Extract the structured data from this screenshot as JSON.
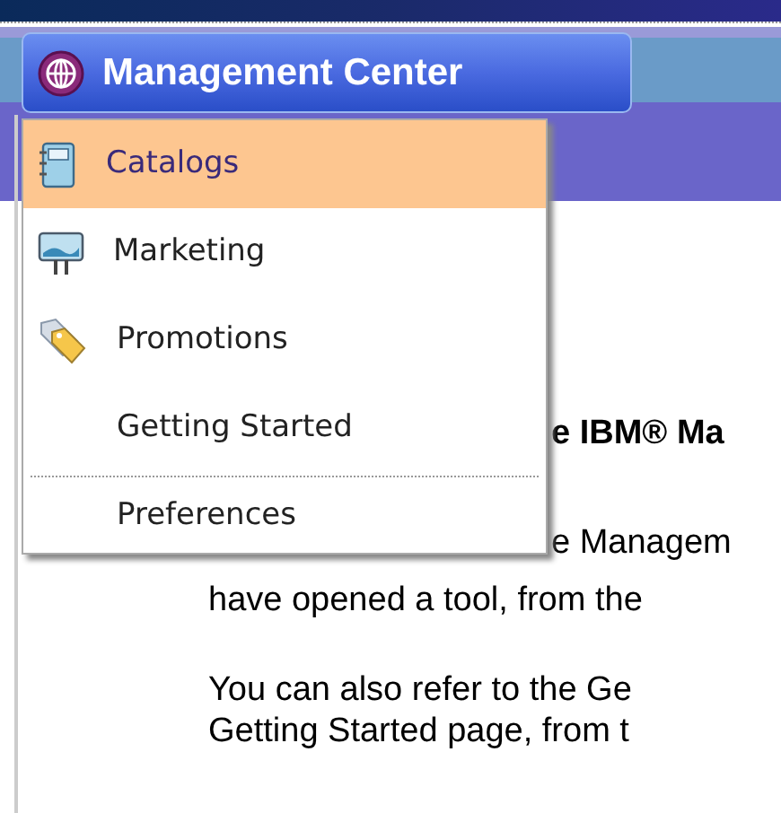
{
  "menu_button": {
    "label": "Management Center",
    "expanded": true
  },
  "menu": {
    "items": [
      {
        "label": "Catalogs",
        "kind": "catalog",
        "selected": true
      },
      {
        "label": "Marketing",
        "kind": "marketing",
        "selected": false
      },
      {
        "label": "Promotions",
        "kind": "promotion",
        "selected": false
      },
      {
        "label": "Getting Started",
        "kind": "plain",
        "selected": false
      },
      {
        "label": "Preferences",
        "kind": "separated",
        "selected": false
      }
    ]
  },
  "content": {
    "heading": "e IBM® Ma",
    "intro": "e Managem",
    "paragraphs": [
      [
        "have opened a tool, from the"
      ],
      [
        "You can also refer to the Ge",
        "Getting Started page, from t"
      ]
    ]
  }
}
